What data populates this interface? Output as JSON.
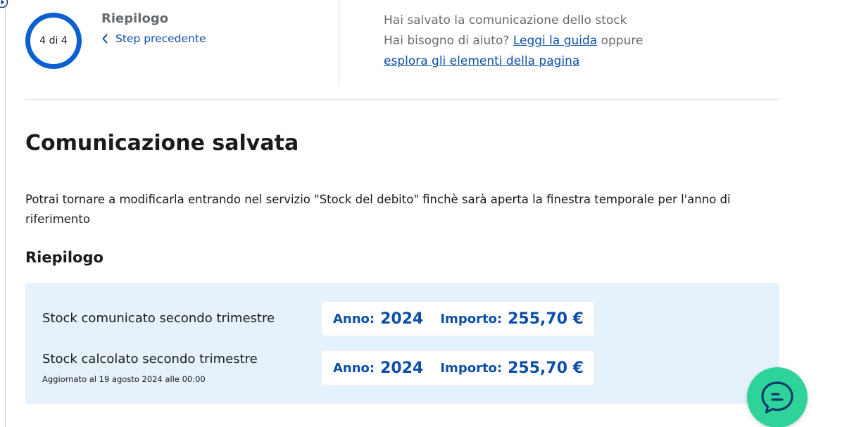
{
  "stepper": {
    "progress": "4 di 4",
    "title": "Riepilogo",
    "back_label": "Step precedente"
  },
  "help": {
    "saved_message": "Hai salvato la comunicazione dello stock",
    "need_help": "Hai bisogno di aiuto?",
    "guide_link": "Leggi la guida",
    "or": "oppure",
    "explore_link": "esplora gli elementi della pagina"
  },
  "main": {
    "title": "Comunicazione salvata",
    "description": "Potrai tornare a modificarla entrando nel servizio \"Stock del debito\" finchè sarà aperta la finestra temporale per l'anno di riferimento",
    "section_title": "Riepilogo"
  },
  "summary": {
    "rows": [
      {
        "label": "Stock comunicato secondo trimestre",
        "sub": "",
        "anno_label": "Anno:",
        "anno_value": "2024",
        "importo_label": "Importo:",
        "importo_value": "255,70 €"
      },
      {
        "label": "Stock calcolato secondo trimestre",
        "sub": "Aggiornato al 19 agosto 2024 alle 00:00",
        "anno_label": "Anno:",
        "anno_value": "2024",
        "importo_label": "Importo:",
        "importo_value": "255,70 €"
      }
    ]
  },
  "colors": {
    "accent": "#0b5fd1",
    "link": "#0b4fa8",
    "card_bg": "#e5f1fb",
    "chat_button": "#2ed39a"
  },
  "icons": {
    "back": "chevron-left-icon",
    "chat": "chat-bubble-icon",
    "corner": "play-circle-icon"
  }
}
